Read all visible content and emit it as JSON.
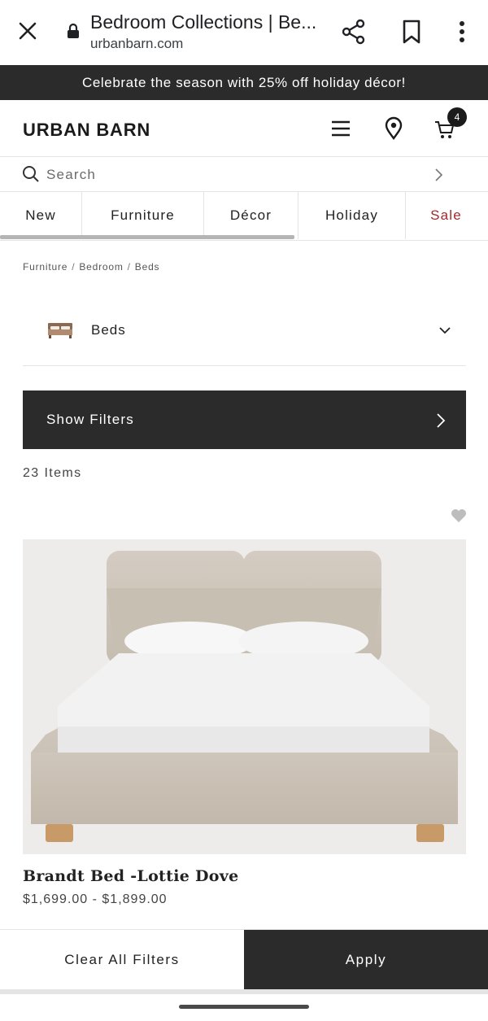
{
  "browser": {
    "tab_title": "Bedroom Collections | Be...",
    "url": "urbanbarn.com"
  },
  "promo": {
    "text": "Celebrate the season with 25% off holiday décor!"
  },
  "header": {
    "logo": "URBAN BARN",
    "cart_count": "4"
  },
  "search": {
    "placeholder": "Search"
  },
  "nav": {
    "tabs": [
      {
        "label": "New"
      },
      {
        "label": "Furniture"
      },
      {
        "label": "Décor"
      },
      {
        "label": "Holiday"
      },
      {
        "label": "Sale"
      }
    ],
    "sale_color": "#a32a2a"
  },
  "breadcrumb": {
    "items": [
      "Furniture",
      "Bedroom",
      "Beds"
    ]
  },
  "category_select": {
    "label": "Beds"
  },
  "filters": {
    "show_label": "Show Filters",
    "item_count": "23 Items"
  },
  "product": {
    "name": "Brandt Bed -Lottie Dove",
    "price": "$1,699.00 - $1,899.00"
  },
  "actions": {
    "clear_label": "Clear All Filters",
    "apply_label": "Apply"
  },
  "colors": {
    "dark": "#2b2b2b",
    "accent_sale": "#a32a2a"
  }
}
